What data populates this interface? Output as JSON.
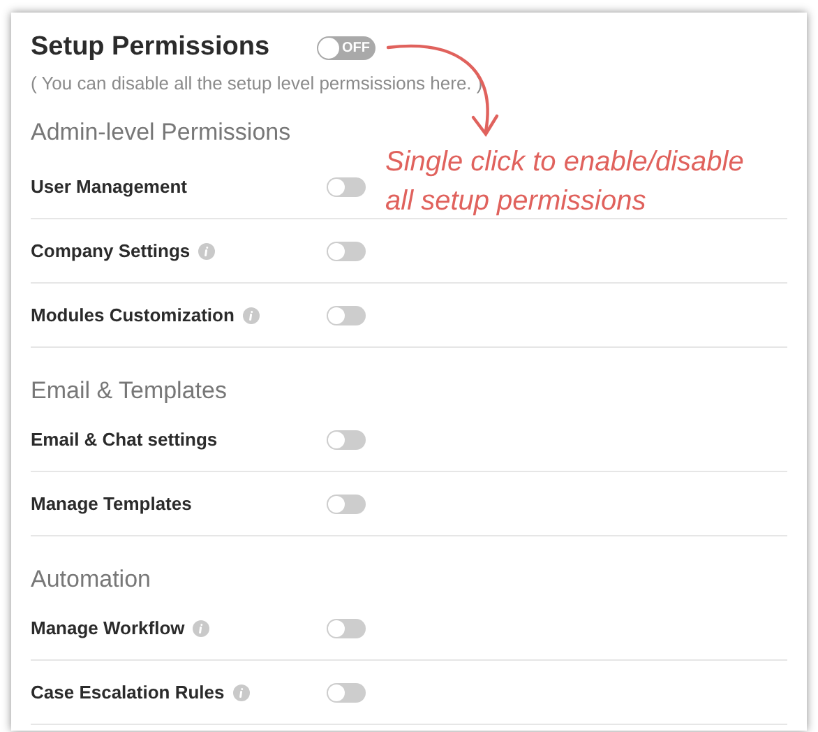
{
  "header": {
    "title": "Setup Permissions",
    "toggle": {
      "label": "OFF",
      "on": false
    },
    "subtitle": "( You can disable all the setup level permsissions here. )"
  },
  "annotation": "Single click to enable/disable all setup permissions",
  "sections": [
    {
      "title": "Admin-level Permissions",
      "items": [
        {
          "label": "User Management",
          "info": false,
          "on": false
        },
        {
          "label": "Company Settings",
          "info": true,
          "on": false
        },
        {
          "label": "Modules Customization",
          "info": true,
          "on": false
        }
      ]
    },
    {
      "title": "Email & Templates",
      "items": [
        {
          "label": "Email & Chat settings",
          "info": false,
          "on": false
        },
        {
          "label": "Manage Templates",
          "info": false,
          "on": false
        }
      ]
    },
    {
      "title": "Automation",
      "items": [
        {
          "label": "Manage Workflow",
          "info": true,
          "on": false
        },
        {
          "label": "Case Escalation Rules",
          "info": true,
          "on": false
        }
      ]
    }
  ]
}
